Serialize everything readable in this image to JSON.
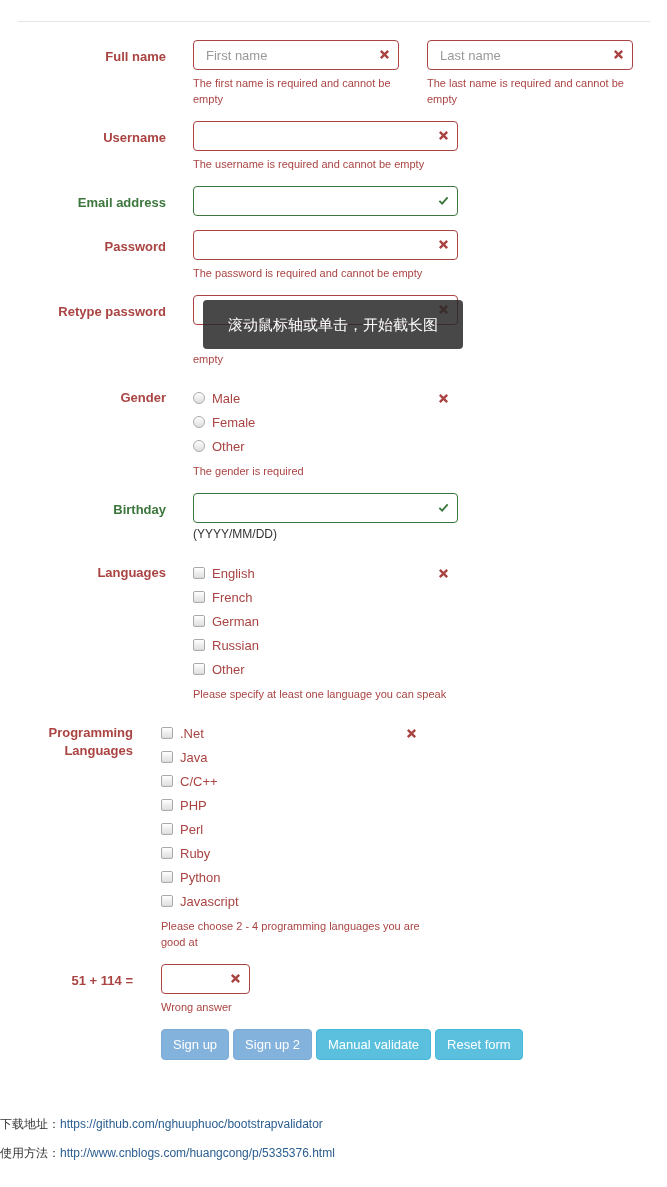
{
  "form": {
    "groups": [
      {
        "kind": "name-pair",
        "label": "Full name",
        "valid": false,
        "inputs": [
          {
            "placeholder": "First name",
            "message": "The first name is required and cannot be empty"
          },
          {
            "placeholder": "Last name",
            "message": "The last name is required and cannot be empty"
          }
        ]
      },
      {
        "kind": "text",
        "label": "Username",
        "valid": false,
        "message": "The username is required and cannot be empty"
      },
      {
        "kind": "text",
        "label": "Email address",
        "valid": true
      },
      {
        "kind": "text",
        "label": "Password",
        "valid": false,
        "message": "The password is required and cannot be empty"
      },
      {
        "kind": "text",
        "label": "Retype password",
        "valid": false,
        "message": "empty"
      },
      {
        "kind": "radio",
        "label": "Gender",
        "valid": false,
        "options": [
          {
            "label": "Male",
            "selected": false
          },
          {
            "label": "Female",
            "selected": false
          },
          {
            "label": "Other",
            "selected": false
          }
        ],
        "message": "The gender is required"
      },
      {
        "kind": "text",
        "label": "Birthday",
        "valid": true,
        "hint": "(YYYY/MM/DD)"
      },
      {
        "kind": "checkbox",
        "label": "Languages",
        "valid": false,
        "options": [
          {
            "label": "English",
            "checked": false
          },
          {
            "label": "French",
            "checked": false
          },
          {
            "label": "German",
            "checked": false
          },
          {
            "label": "Russian",
            "checked": false
          },
          {
            "label": "Other",
            "checked": false
          }
        ],
        "message": "Please specify at least one language you can speak"
      },
      {
        "kind": "checkbox",
        "compact": true,
        "label": "Programming Languages",
        "valid": false,
        "options": [
          {
            "label": ".Net",
            "checked": false
          },
          {
            "label": "Java",
            "checked": false
          },
          {
            "label": "C/C++",
            "checked": false
          },
          {
            "label": "PHP",
            "checked": false
          },
          {
            "label": "Perl",
            "checked": false
          },
          {
            "label": "Ruby",
            "checked": false
          },
          {
            "label": "Python",
            "checked": false
          },
          {
            "label": "Javascript",
            "checked": false
          }
        ],
        "message": "Please choose 2 - 4 programming languages you are good at"
      },
      {
        "kind": "captcha",
        "compact": true,
        "label": "51 + 114 =",
        "valid": false,
        "message": "Wrong answer"
      }
    ],
    "buttons": [
      {
        "label": "Sign up",
        "kind": "primary",
        "disabled": true
      },
      {
        "label": "Sign up 2",
        "kind": "primary",
        "disabled": true
      },
      {
        "label": "Manual validate",
        "kind": "info",
        "disabled": false
      },
      {
        "label": "Reset form",
        "kind": "info",
        "disabled": false
      }
    ]
  },
  "footer": [
    {
      "label": "下载地址：",
      "link": "https://github.com/nghuuphuoc/bootstrapvalidator"
    },
    {
      "label": "使用方法：",
      "link": "http://www.cnblogs.com/huangcong/p/5335376.html"
    }
  ],
  "toast": {
    "text": "滚动鼠标轴或单击，开始截长图"
  }
}
